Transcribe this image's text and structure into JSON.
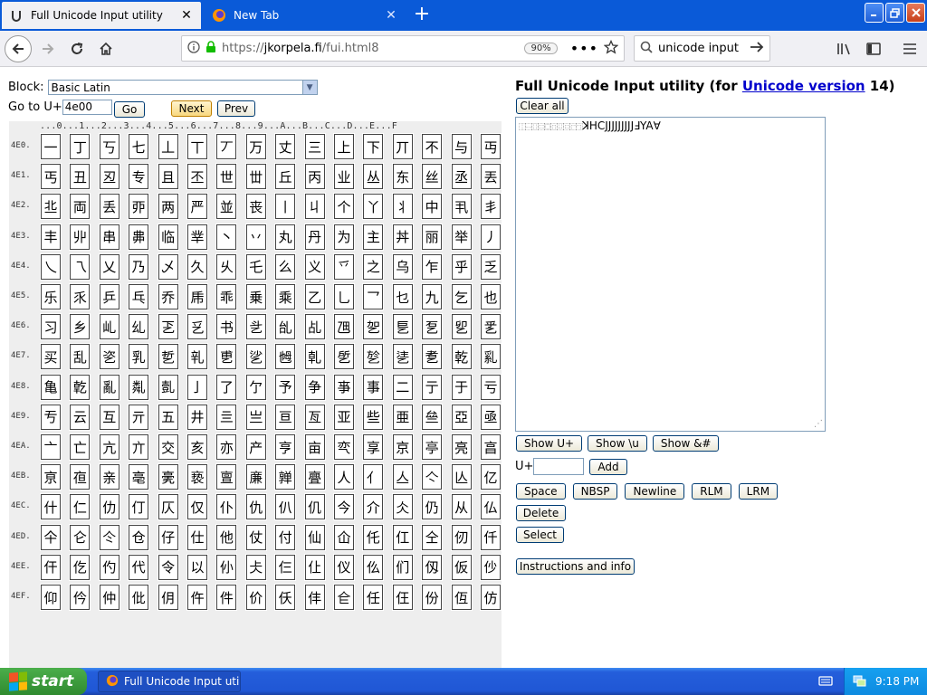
{
  "browser": {
    "tabs": [
      {
        "title": "Full Unicode Input utility",
        "close": "✕"
      },
      {
        "title": "New Tab",
        "close": "✕"
      }
    ],
    "new_tab_symbol": "+",
    "url": {
      "protocol": "https://",
      "host": "jkorpela.fi",
      "path": "/fui.html8"
    },
    "zoom": "90%",
    "url_menu": "•••",
    "search_text": "unicode input"
  },
  "page": {
    "block_label": "Block:",
    "block_value": "Basic Latin",
    "goto_label": "Go to U+",
    "goto_value": "4e00",
    "go_label": "Go",
    "next_label": "Next",
    "prev_label": "Prev",
    "column_header": "...0...1...2...3...4...5...6...7...8...9...A...B...C...D...E...F",
    "grid": {
      "start_codepoint": "4E00",
      "row_labels": [
        "4E0.",
        "4E1.",
        "4E2.",
        "4E3.",
        "4E4.",
        "4E5.",
        "4E6.",
        "4E7.",
        "4E8.",
        "4E9.",
        "4EA.",
        "4EB.",
        "4EC.",
        "4ED.",
        "4EE.",
        "4EF."
      ],
      "rows": [
        "一丁丂七丄丅丆万丈三上下丌不与丏",
        "丐丑丒专且丕世丗丘丙业丛东丝丞丟",
        "丠両丢丣两严並丧丨丩个丫丬中丮丯",
        "丰丱串丳临丵丶丷丸丹为主丼丽举丿",
        "乀乁乂乃乄久乆乇么义乊之乌乍乎乏",
        "乐乑乒乓乔乕乖乗乘乙乚乛乜九乞也",
        "习乡乢乣乤乥书乧乨乩乪乫乬乭乮乯",
        "买乱乲乳乴乵乶乷乸乹乺乻乼乽乾乿",
        "亀亁亂亃亄亅了亇予争亊事二亍于亏",
        "亐云互亓五井亖亗亘亙亚些亜亝亞亟",
        "亠亡亢亣交亥亦产亨亩亪享京亭亮亯",
        "亰亱亲亳亴亵亶亷亸亹人亻亼亽亾亿",
        "什仁仂仃仄仅仆仇仈仉今介仌仍从仏",
        "仐仑仒仓仔仕他仗付仙仚仛仜仝仞仟",
        "仠仡仢代令以仦仧仨仩仪仫们仭仮仯",
        "仰仱仲仳仴仵件价仸仹仺任仼份仾仿"
      ]
    },
    "title_prefix": "Full Unicode Input utility (for ",
    "title_link": "Unicode version",
    "title_suffix": " 14)",
    "clear_all_label": "Clear all",
    "output": {
      "tofu": "⿰⿱⿲⿳⿴⿵⿶⿷⿸⿹",
      "text": "ꓘHCJJJJJJJJJꓞYA∀"
    },
    "show_uplus_label": "Show U+",
    "show_u_label": "Show \\u",
    "show_amp_label": "Show &#",
    "uplus_label": "U+",
    "uplus_value": "",
    "add_label": "Add",
    "space_label": "Space",
    "nbsp_label": "NBSP",
    "newline_label": "Newline",
    "rlm_label": "RLM",
    "lrm_label": "LRM",
    "delete_label": "Delete",
    "select_label": "Select",
    "info_label": "Instructions and info"
  },
  "taskbar": {
    "start_label": "start",
    "task_label": "Full Unicode Input util...",
    "clock": "9:18 PM"
  },
  "colors": {
    "titlebar_blue": "#0a5ad8",
    "link_blue": "#0000cc",
    "taskbar_blue": "#245edb",
    "start_green": "#3c9c3c"
  }
}
